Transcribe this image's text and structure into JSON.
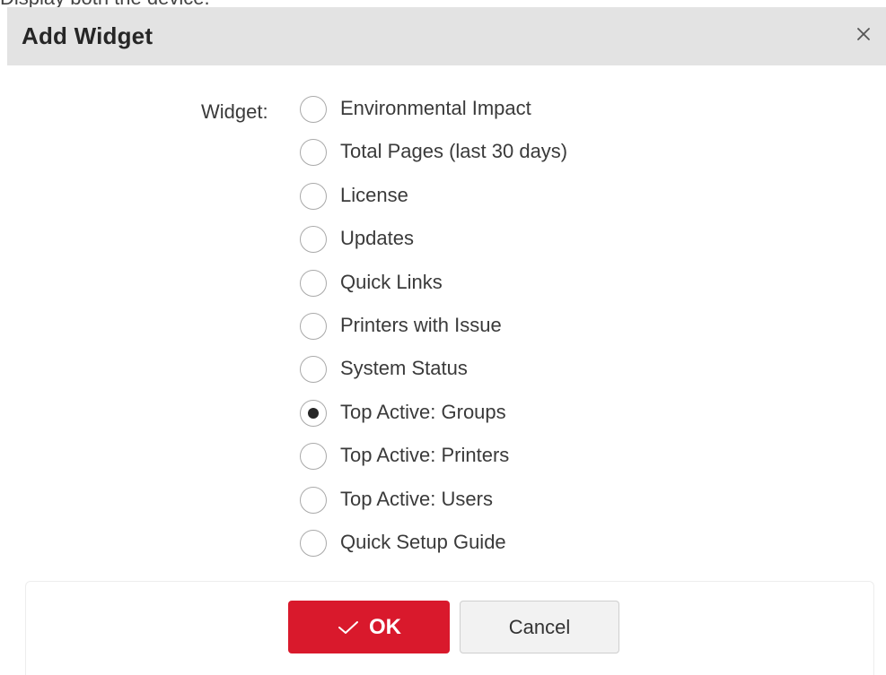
{
  "top_cut_text": "Display both the device.",
  "dialog": {
    "title": "Add Widget",
    "close_icon": "close-icon"
  },
  "form": {
    "widget_label": "Widget:",
    "selected_index": 7,
    "options": [
      {
        "label": "Environmental Impact",
        "checked": false
      },
      {
        "label": "Total Pages (last 30 days)",
        "checked": false
      },
      {
        "label": "License",
        "checked": false
      },
      {
        "label": "Updates",
        "checked": false
      },
      {
        "label": "Quick Links",
        "checked": false
      },
      {
        "label": "Printers with Issue",
        "checked": false
      },
      {
        "label": "System Status",
        "checked": false
      },
      {
        "label": "Top Active: Groups",
        "checked": true
      },
      {
        "label": "Top Active: Printers",
        "checked": false
      },
      {
        "label": "Top Active: Users",
        "checked": false
      },
      {
        "label": "Quick Setup Guide",
        "checked": false
      }
    ]
  },
  "buttons": {
    "ok_label": "OK",
    "ok_icon": "checkmark-icon",
    "cancel_label": "Cancel"
  },
  "colors": {
    "header_bg": "#e3e3e3",
    "accent": "#d9192c"
  }
}
